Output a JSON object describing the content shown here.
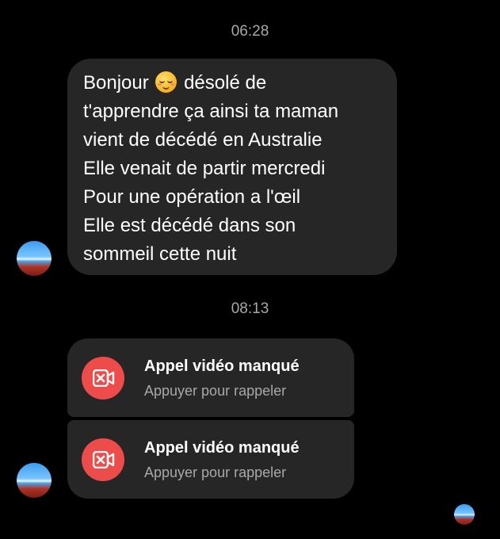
{
  "thread": {
    "timestamp_1": "06:28",
    "timestamp_2": "08:13"
  },
  "message": {
    "line_1_before_emoji": "Bonjour",
    "emoji": "relieved-face-emoji",
    "line_1_after_emoji": "désolé de",
    "line_2": "t'apprendre ça ainsi ta maman",
    "line_3": "vient de décédé en Australie",
    "line_4": "Elle venait de partir mercredi",
    "line_5": "Pour une opération a l'œil",
    "line_6": "Elle est décédé dans son",
    "line_7": "sommeil cette nuit"
  },
  "calls": [
    {
      "icon": "missed-video-call-icon",
      "title": "Appel vidéo manqué",
      "subtitle": "Appuyer pour rappeler"
    },
    {
      "icon": "missed-video-call-icon",
      "title": "Appel vidéo manqué",
      "subtitle": "Appuyer pour rappeler"
    }
  ],
  "colors": {
    "background": "#000000",
    "bubble": "#262626",
    "missed_call_red": "#ee4b4b",
    "secondary_text": "#a8a8a8"
  }
}
